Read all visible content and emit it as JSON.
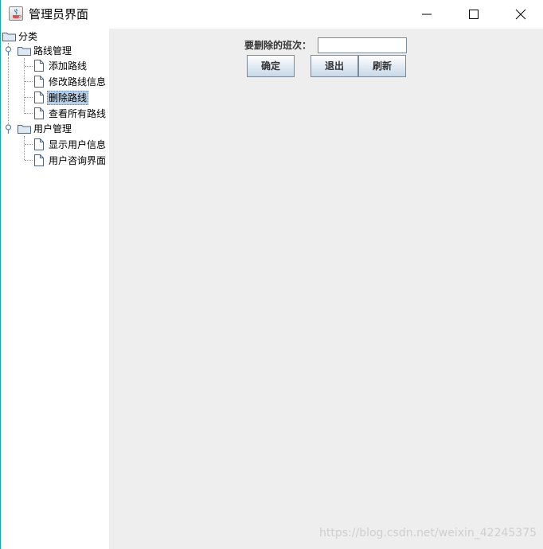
{
  "window": {
    "title": "管理员界面"
  },
  "tree": {
    "root": "分类",
    "groups": [
      {
        "label": "路线管理",
        "items": [
          "添加路线",
          "修改路线信息",
          "删除路线",
          "查看所有路线"
        ]
      },
      {
        "label": "用户管理",
        "items": [
          "显示用户信息",
          "用户咨询界面"
        ]
      }
    ],
    "selected": "删除路线"
  },
  "form": {
    "label": "要删除的班次：",
    "input_value": "",
    "ok_label": "确定",
    "exit_label": "退出",
    "refresh_label": "刷新"
  },
  "watermark": "https://blog.csdn.net/weixin_42245375",
  "colors": {
    "content_bg": "#eeeeee",
    "selection_bg": "#b8cfe5",
    "window_border": "#1aa7a7"
  }
}
